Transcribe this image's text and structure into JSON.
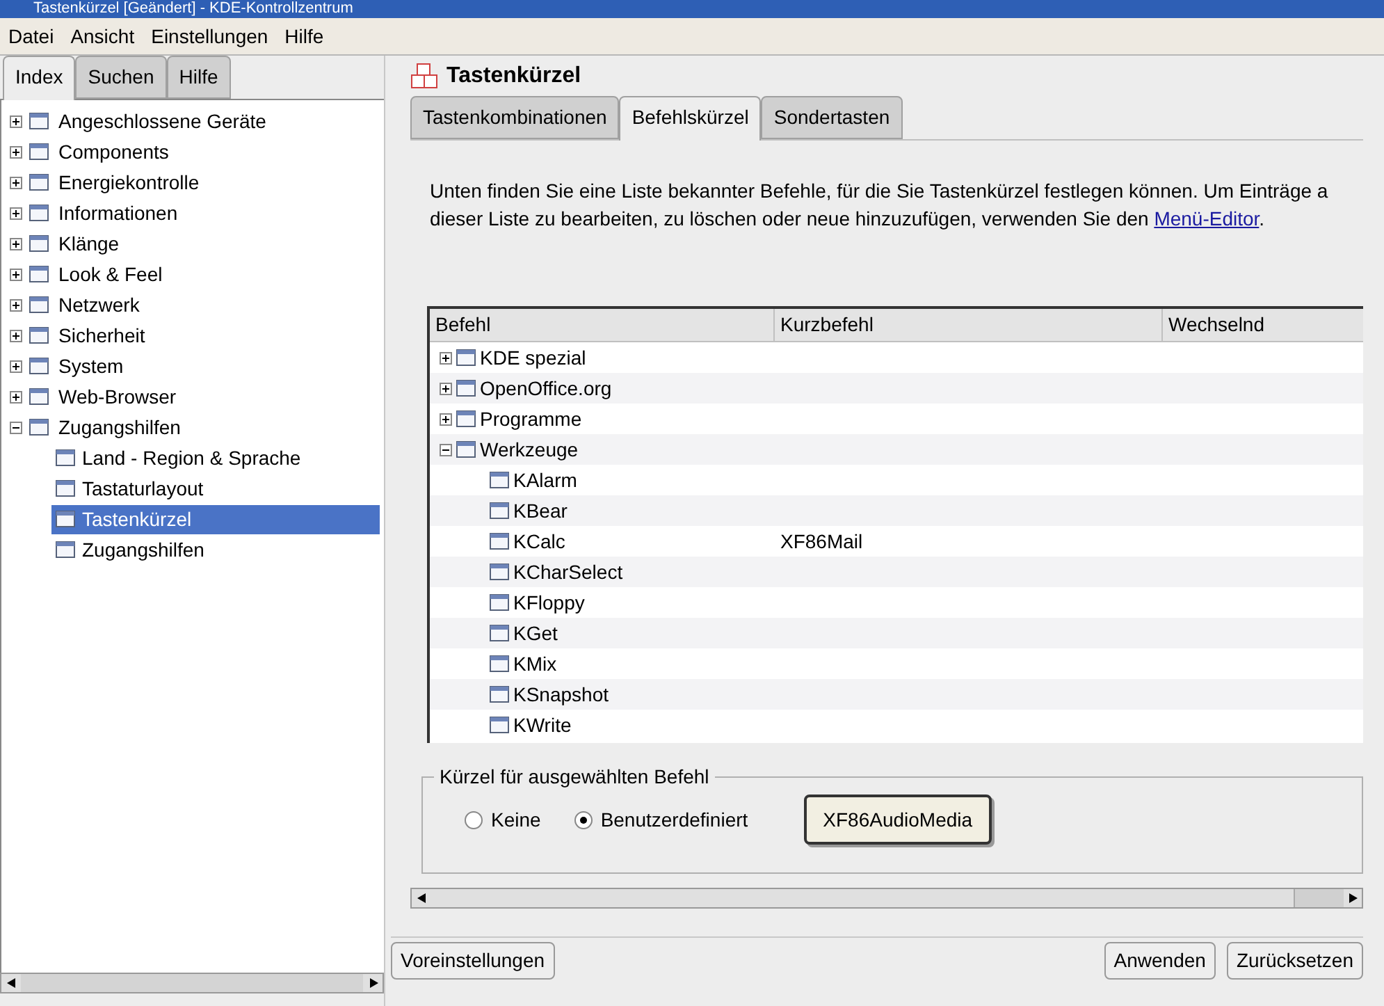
{
  "window": {
    "title": "Tastenkürzel [Geändert] - KDE-Kontrollzentrum"
  },
  "menu": [
    "Datei",
    "Ansicht",
    "Einstellungen",
    "Hilfe"
  ],
  "sidebar": {
    "tabs": [
      {
        "label": "Index",
        "selected": true
      },
      {
        "label": "Suchen",
        "selected": false
      },
      {
        "label": "Hilfe",
        "selected": false
      }
    ],
    "items": [
      {
        "label": "Angeschlossene Geräte",
        "expanded": false,
        "selected": false
      },
      {
        "label": "Components",
        "expanded": false,
        "selected": false
      },
      {
        "label": "Energiekontrolle",
        "expanded": false,
        "selected": false
      },
      {
        "label": "Informationen",
        "expanded": false,
        "selected": false
      },
      {
        "label": "Klänge",
        "expanded": false,
        "selected": false
      },
      {
        "label": "Look & Feel",
        "expanded": false,
        "selected": false
      },
      {
        "label": "Netzwerk",
        "expanded": false,
        "selected": false
      },
      {
        "label": "Sicherheit",
        "expanded": false,
        "selected": false
      },
      {
        "label": "System",
        "expanded": false,
        "selected": false
      },
      {
        "label": "Web-Browser",
        "expanded": false,
        "selected": false
      },
      {
        "label": "Zugangshilfen",
        "expanded": true,
        "selected": false,
        "children": [
          {
            "label": "Land - Region & Sprache",
            "selected": false
          },
          {
            "label": "Tastaturlayout",
            "selected": false
          },
          {
            "label": "Tastenkürzel",
            "selected": true
          },
          {
            "label": "Zugangshilfen",
            "selected": false
          }
        ]
      }
    ]
  },
  "module": {
    "title": "Tastenkürzel",
    "tabs": [
      {
        "label": "Tastenkombinationen",
        "selected": false
      },
      {
        "label": "Befehlskürzel",
        "selected": true
      },
      {
        "label": "Sondertasten",
        "selected": false
      }
    ],
    "description": "Unten finden Sie eine Liste bekannter Befehle, für die Sie Tastenkürzel festlegen können. Um Einträge a dieser Liste zu bearbeiten, zu löschen oder neue hinzuzufügen, verwenden Sie den",
    "description_link": "Menü-Editor",
    "description_end": ".",
    "table": {
      "columns": [
        "Befehl",
        "Kurzbefehl",
        "Wechselnd"
      ],
      "rows": [
        {
          "command": "KDE spezial",
          "expanded": false
        },
        {
          "command": "OpenOffice.org",
          "expanded": false
        },
        {
          "command": "Programme",
          "expanded": false
        },
        {
          "command": "Werkzeuge",
          "expanded": true,
          "children": [
            {
              "command": "KAlarm"
            },
            {
              "command": "KBear"
            },
            {
              "command": "KCalc",
              "shortcut": "XF86Mail"
            },
            {
              "command": "KCharSelect"
            },
            {
              "command": "KFloppy"
            },
            {
              "command": "KGet"
            },
            {
              "command": "KMix"
            },
            {
              "command": "KSnapshot"
            },
            {
              "command": "KWrite"
            }
          ]
        }
      ]
    },
    "shortcut_group": {
      "title": "Kürzel für ausgewählten Befehl",
      "options": [
        {
          "label": "Keine",
          "selected": false
        },
        {
          "label": "Benutzerdefiniert",
          "selected": true
        }
      ],
      "key_button": "XF86AudioMedia"
    }
  },
  "buttons": {
    "left": [
      "Voreinstellungen"
    ],
    "right": [
      "Anwenden",
      "Zurücksetzen"
    ]
  }
}
